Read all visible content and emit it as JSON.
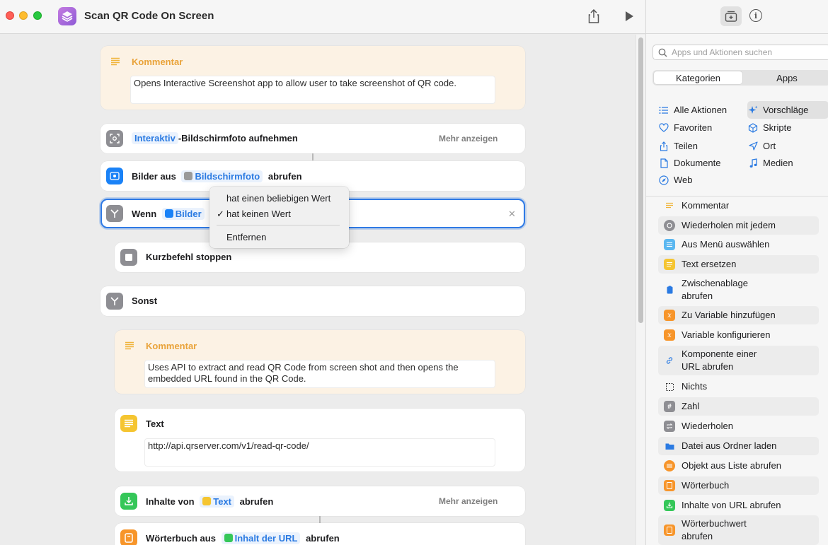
{
  "window": {
    "title": "Scan QR Code On Screen"
  },
  "editor": {
    "comment1": {
      "title": "Kommentar",
      "text": "Opens Interactive Screenshot app to allow user to take screenshot of QR code."
    },
    "action1": {
      "token": "Interaktiv",
      "text": "-Bildschirmfoto aufnehmen",
      "more": "Mehr anzeigen"
    },
    "action2": {
      "prefix": "Bilder aus",
      "token": "Bildschirmfoto",
      "suffix": "abrufen"
    },
    "action3": {
      "prefix": "Wenn",
      "token": "Bilder"
    },
    "action4": {
      "text": "Kurzbefehl stoppen"
    },
    "action5": {
      "text": "Sonst"
    },
    "comment2": {
      "title": "Kommentar",
      "line1": "Uses API to extract and read QR Code from screen shot and then opens the",
      "line2": "embedded URL found in the QR Code."
    },
    "text_action": {
      "title": "Text",
      "value": "http://api.qrserver.com/v1/read-qr-code/"
    },
    "action7": {
      "prefix": "Inhalte von",
      "token": "Text",
      "suffix": "abrufen",
      "more": "Mehr anzeigen"
    },
    "action8": {
      "prefix": "Wörterbuch aus",
      "token": "Inhalt der URL",
      "suffix": "abrufen"
    }
  },
  "menu": {
    "item1": "hat einen beliebigen Wert",
    "item2": "hat keinen Wert",
    "check": "✓",
    "item3": "Entfernen"
  },
  "sidebar": {
    "search_placeholder": "Apps und Aktionen suchen",
    "tabs": {
      "active": "Kategorien",
      "inactive": "Apps"
    },
    "categories": {
      "all": "Alle Aktionen",
      "suggestions": "Vorschläge",
      "favorites": "Favoriten",
      "scripts": "Skripte",
      "share": "Teilen",
      "location": "Ort",
      "documents": "Dokumente",
      "media": "Medien",
      "web": "Web"
    },
    "library": [
      {
        "label": "Kommentar",
        "line2": ""
      },
      {
        "label": "Wiederholen mit jedem",
        "line2": ""
      },
      {
        "label": "Aus Menü auswählen",
        "line2": ""
      },
      {
        "label": "Text ersetzen",
        "line2": ""
      },
      {
        "label": "Zwischenablage",
        "line2": "abrufen"
      },
      {
        "label": "Zu Variable hinzufügen",
        "line2": ""
      },
      {
        "label": "Variable konfigurieren",
        "line2": ""
      },
      {
        "label": "Komponente einer",
        "line2": "URL abrufen"
      },
      {
        "label": "Nichts",
        "line2": ""
      },
      {
        "label": "Zahl",
        "line2": ""
      },
      {
        "label": "Wiederholen",
        "line2": ""
      },
      {
        "label": "Datei aus Ordner laden",
        "line2": ""
      },
      {
        "label": "Objekt aus Liste abrufen",
        "line2": ""
      },
      {
        "label": "Wörterbuch",
        "line2": ""
      },
      {
        "label": "Inhalte von URL abrufen",
        "line2": ""
      },
      {
        "label": "Wörterbuchwert",
        "line2": "abrufen"
      }
    ]
  }
}
